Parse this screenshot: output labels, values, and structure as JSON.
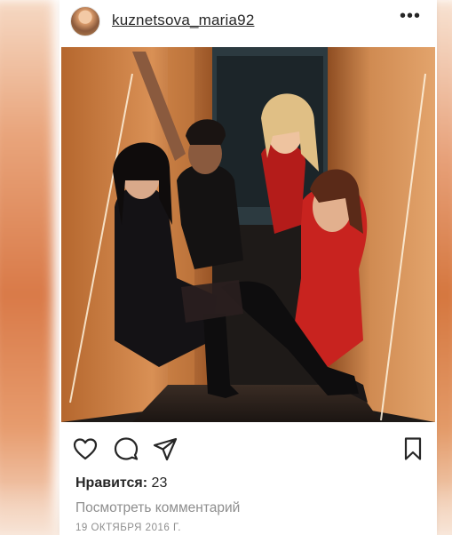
{
  "post": {
    "username": "kuznetsova_maria92",
    "more_icon": "more-horizontal-icon",
    "likes_label": "Нравится:",
    "likes_count": "23",
    "view_comments": "Посмотреть комментарий",
    "date": "19 ОКТЯБРЯ 2016 Г.",
    "actions": [
      "heart-icon",
      "comment-icon",
      "share-icon",
      "bookmark-icon"
    ]
  },
  "colors": {
    "text": "#262626",
    "secondary_text": "#8e8e8e",
    "accent_background": "#e08a55"
  }
}
